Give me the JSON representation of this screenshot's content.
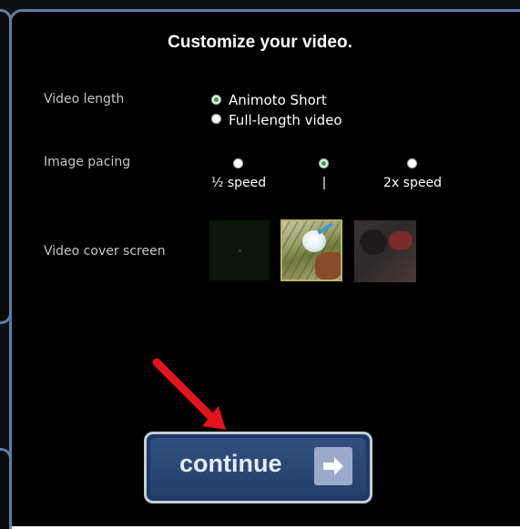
{
  "dialog": {
    "title": "Customize your video."
  },
  "video_length": {
    "label": "Video length",
    "options": [
      {
        "label": "Animoto Short",
        "selected": true
      },
      {
        "label": "Full-length video",
        "selected": false
      }
    ]
  },
  "image_pacing": {
    "label": "Image pacing",
    "options": [
      {
        "label": "½ speed",
        "selected": false
      },
      {
        "label": "|",
        "selected": true
      },
      {
        "label": "2x speed",
        "selected": false
      }
    ]
  },
  "cover_screen": {
    "label": "Video cover screen",
    "thumbnails": [
      {
        "icon": "dark-green-frame",
        "selected": false
      },
      {
        "icon": "cup-and-shoe-photo",
        "selected": true
      },
      {
        "icon": "dark-photo-with-red-object",
        "selected": false
      }
    ]
  },
  "continue_button": {
    "label": "continue",
    "icon": "arrow-right-icon"
  },
  "colors": {
    "accent": "#1d3a6a",
    "radio_selected": "#2aa23a",
    "annotation_arrow": "#e3151b"
  }
}
